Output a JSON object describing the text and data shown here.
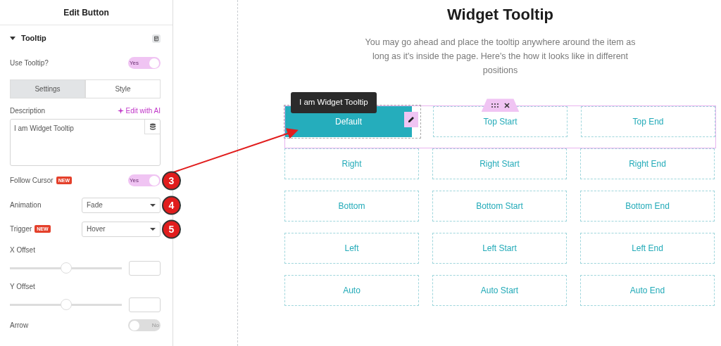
{
  "panel": {
    "title": "Edit Button",
    "section": {
      "title": "Tooltip",
      "expanded": true
    },
    "controls": [
      {
        "kind": "switch",
        "label": "Use Tooltip?",
        "on": true,
        "state_label": "Yes"
      },
      {
        "kind": "tabs",
        "tabs": [
          {
            "label": "Settings",
            "selected": true
          },
          {
            "label": "Style",
            "selected": false
          }
        ]
      },
      {
        "kind": "textarea",
        "label": "Description",
        "action": "Edit with AI",
        "value": "I am Widget Tooltip"
      },
      {
        "kind": "switch",
        "label": "Follow Cursor",
        "badge": "NEW",
        "on": true,
        "state_label": "Yes",
        "callout": "3"
      },
      {
        "kind": "select",
        "label": "Animation",
        "value": "Fade",
        "callout": "4"
      },
      {
        "kind": "select",
        "label": "Trigger",
        "badge": "NEW",
        "value": "Hover",
        "callout": "5"
      },
      {
        "kind": "slider",
        "label": "X Offset",
        "level": 0.5
      },
      {
        "kind": "slider",
        "label": "Y Offset",
        "level": 0.5
      },
      {
        "kind": "switch",
        "label": "Arrow",
        "on": false,
        "state_label": "No"
      }
    ]
  },
  "canvas": {
    "heading": "Widget Tooltip",
    "description": "You may go ahead and place the tooltip anywhere around the item as long as it's inside the page. Here's the how it looks like in different positions",
    "tooltip": "I am Widget Tooltip",
    "buttons": [
      {
        "label": "Default",
        "selected": true
      },
      {
        "label": "Top Start",
        "selected": false
      },
      {
        "label": "Top End",
        "selected": false
      },
      {
        "label": "Right",
        "selected": false
      },
      {
        "label": "Right Start",
        "selected": false
      },
      {
        "label": "Right End",
        "selected": false
      },
      {
        "label": "Bottom",
        "selected": false
      },
      {
        "label": "Bottom Start",
        "selected": false
      },
      {
        "label": "Bottom End",
        "selected": false
      },
      {
        "label": "Left",
        "selected": false
      },
      {
        "label": "Left Start",
        "selected": false
      },
      {
        "label": "Left End",
        "selected": false
      },
      {
        "label": "Auto",
        "selected": false
      },
      {
        "label": "Auto Start",
        "selected": false
      },
      {
        "label": "Auto End",
        "selected": false
      }
    ]
  }
}
